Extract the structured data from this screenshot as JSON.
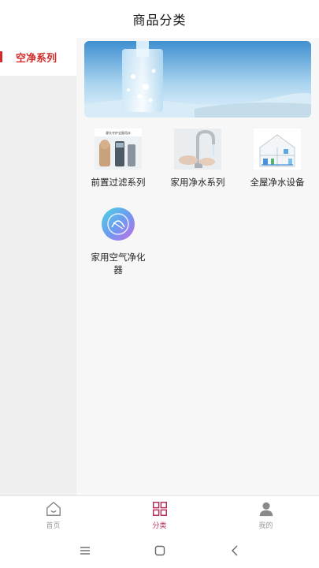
{
  "header": {
    "title": "商品分类"
  },
  "sidebar": {
    "items": [
      {
        "label": "空净系列",
        "selected": true
      }
    ]
  },
  "categories": [
    {
      "label": "前置过滤系列",
      "image_caption": "源头守护全屋用水",
      "icon": "pre-filter-product-image"
    },
    {
      "label": "家用净水系列",
      "icon": "faucet-image"
    },
    {
      "label": "全屋净水设备",
      "icon": "house-water-system-image"
    },
    {
      "label": "家用空气净化器",
      "icon": "air-purifier-image"
    }
  ],
  "tabbar": {
    "items": [
      {
        "label": "首页",
        "icon": "home-icon",
        "active": false
      },
      {
        "label": "分类",
        "icon": "grid-icon",
        "active": true
      },
      {
        "label": "我的",
        "icon": "user-icon",
        "active": false
      }
    ]
  },
  "colors": {
    "accent": "#d22a2a",
    "tab_active": "#b0305a",
    "tab_inactive": "#999999"
  }
}
